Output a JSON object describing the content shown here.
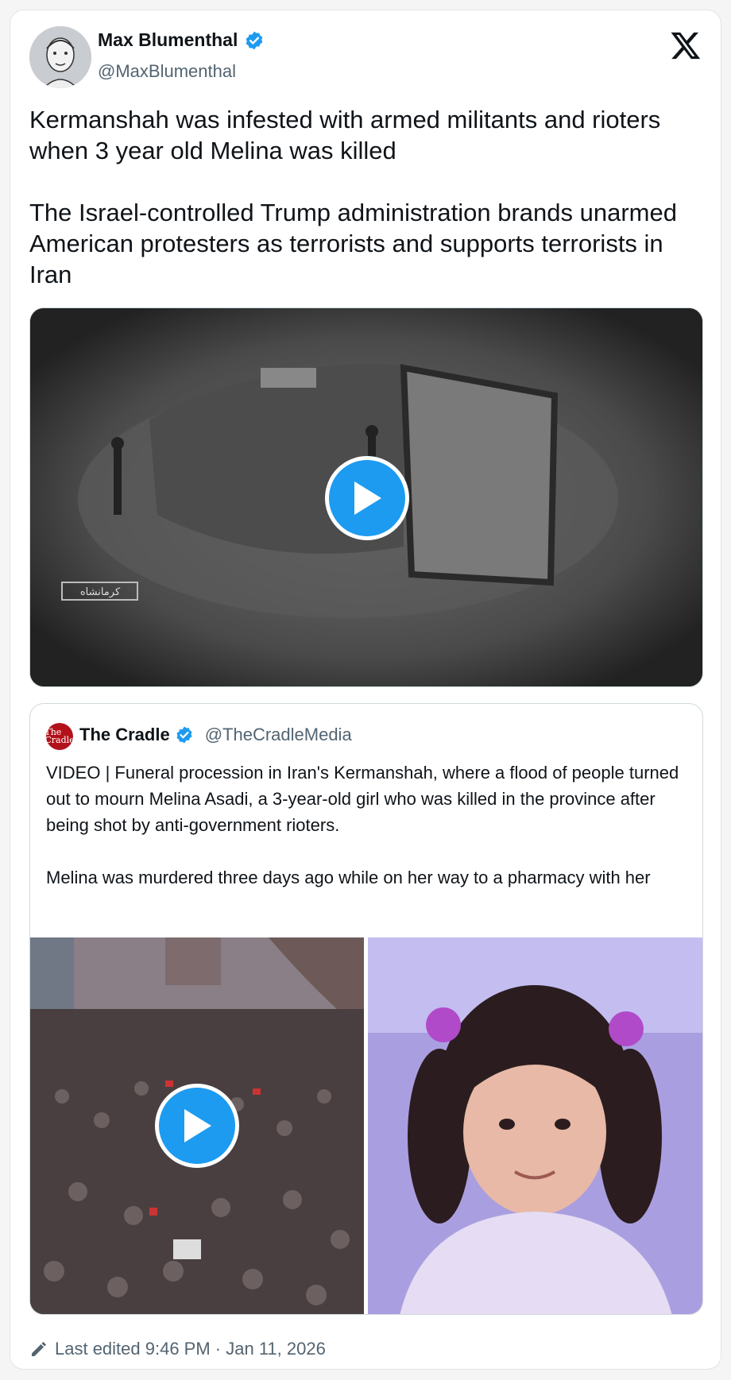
{
  "author": {
    "name": "Max Blumenthal",
    "handle": "@MaxBlumenthal"
  },
  "tweet": {
    "text": "Kermanshah was infested with armed militants and rioters when 3 year old Melina was killed\n\nThe Israel-controlled Trump administration brands unarmed American protesters as terrorists and supports terrorists in Iran"
  },
  "media": {
    "watermark": "کرمانشاه"
  },
  "quote": {
    "name": "The Cradle",
    "handle": "@TheCradleMedia",
    "avatar_text": "The Cradle",
    "text": "VIDEO | Funeral procession in Iran's Kermanshah, where a flood of people turned out to mourn Melina Asadi, a 3-year-old girl who was killed in the province after being shot by anti-government rioters.\n\nMelina was murdered three days ago while on her way to a pharmacy with her"
  },
  "footer": {
    "edited": "Last edited 9:46 PM · Jan 11, 2026"
  },
  "colors": {
    "accent": "#1d9bf0",
    "text_primary": "#0f1419",
    "text_secondary": "#536471"
  },
  "icons": [
    "verified-badge-icon",
    "x-logo-icon",
    "play-icon",
    "edit-pencil-icon"
  ]
}
